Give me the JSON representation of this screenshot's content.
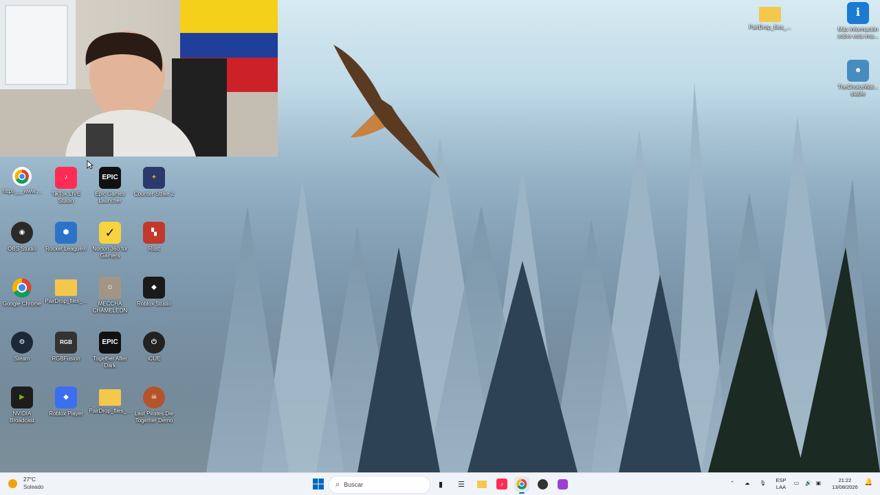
{
  "desktop": {
    "icons": [
      {
        "label": "https___www....",
        "icon": "chrome-shortcut-icon",
        "color": "#ffffff"
      },
      {
        "label": "TikTok LIVE Studio",
        "icon": "tiktok-live-icon",
        "color": "#fe2c55"
      },
      {
        "label": "Epic Games Launcher",
        "icon": "epic-games-icon",
        "color": "#111111",
        "glyph": "EPIC"
      },
      {
        "label": "Counter-Strike 2",
        "icon": "counter-strike-icon",
        "color": "#e8a03a"
      },
      {
        "label": "OBS Studio",
        "icon": "obs-icon",
        "color": "#2a2a2a"
      },
      {
        "label": "Rocket League®",
        "icon": "rocket-league-icon",
        "color": "#2b73c9"
      },
      {
        "label": "Norton 360 for Gamers",
        "icon": "norton-icon",
        "color": "#f6d33f",
        "glyph": "✓"
      },
      {
        "label": "Rust",
        "icon": "rust-icon",
        "color": "#c0392b"
      },
      {
        "label": "Google Chrome",
        "icon": "google-chrome-icon",
        "color": "#ffffff"
      },
      {
        "label": "PairDrop_files_...",
        "icon": "folder-icon",
        "color": "#f4c84b"
      },
      {
        "label": "MECCHA CHAMELEON",
        "icon": "meccha-chameleon-icon",
        "color": "#a39584"
      },
      {
        "label": "Roblox Studio",
        "icon": "roblox-studio-icon",
        "color": "#1a1a1a"
      },
      {
        "label": "Steam",
        "icon": "steam-icon",
        "color": "#1b2838"
      },
      {
        "label": "RGBFusion",
        "icon": "rgb-fusion-icon",
        "color": "#333333",
        "glyph": "RGB"
      },
      {
        "label": "Together After Dark",
        "icon": "epic-games-icon",
        "color": "#111111",
        "glyph": "EPIC"
      },
      {
        "label": "iCUE",
        "icon": "icue-icon",
        "color": "#222222"
      },
      {
        "label": "NVIDIA Broadcast",
        "icon": "nvidia-broadcast-icon",
        "color": "#1d1d1d"
      },
      {
        "label": "Roblox Player",
        "icon": "roblox-player-icon",
        "color": "#3b6ff0"
      },
      {
        "label": "PairDrop_files_...",
        "icon": "folder-icon",
        "color": "#f4c84b"
      },
      {
        "label": "Last Pirates Die Together Demo",
        "icon": "last-pirates-icon",
        "color": "#b5532b"
      }
    ],
    "right_icons": [
      {
        "label": "PairDrop_files_...",
        "icon": "folder-icon"
      },
      {
        "label": "Más información sobre esta ima...",
        "icon": "info-icon"
      },
      {
        "label": "TheChoiceWal... stable",
        "icon": "godot-icon"
      }
    ]
  },
  "taskbar": {
    "weather": {
      "temp": "27°C",
      "condition": "Soleado"
    },
    "search_placeholder": "Buscar",
    "language": {
      "line1": "ESP",
      "line2": "LAA"
    },
    "clock": {
      "time": "21:22",
      "date": "13/08/2026"
    }
  },
  "colors": {
    "taskbar": "#f0f3f7",
    "accent": "#0067c0"
  }
}
